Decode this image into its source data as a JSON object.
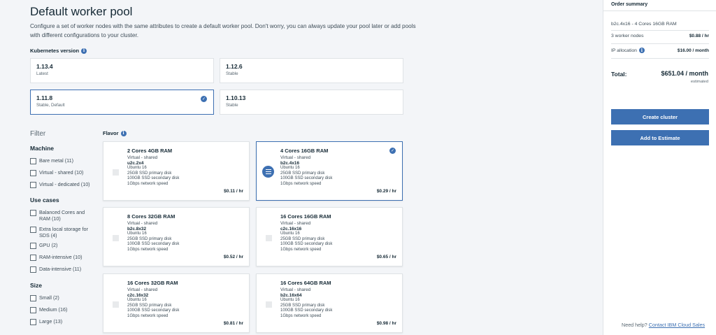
{
  "page": {
    "title": "Default worker pool",
    "description": "Configure a set of worker nodes with the same attributes to create a default worker pool. Don't worry, you can always update your pool later or add pools with different configurations to your cluster."
  },
  "kubernetes": {
    "label": "Kubernetes version",
    "versions": [
      {
        "version": "1.13.4",
        "status": "Latest"
      },
      {
        "version": "1.12.6",
        "status": "Stable"
      },
      {
        "version": "1.11.8",
        "status": "Stable, Default"
      },
      {
        "version": "1.10.13",
        "status": "Stable"
      }
    ],
    "selected": "1.11.8"
  },
  "filter": {
    "title": "Filter",
    "machine": {
      "label": "Machine",
      "options": [
        "Bare metal (11)",
        "Virtual - shared (10)",
        "Virtual - dedicated (10)"
      ]
    },
    "use_cases": {
      "label": "Use cases",
      "options": [
        "Balanced Cores and RAM (10)",
        "Extra local storage for SDS (4)",
        "GPU (2)",
        "RAM-intensive (10)",
        "Data-intensive (11)"
      ]
    },
    "size": {
      "label": "Size",
      "options": [
        "Small (2)",
        "Medium (16)",
        "Large (13)"
      ]
    }
  },
  "flavor": {
    "label": "Flavor",
    "cards": [
      {
        "title": "2 Cores 4GB RAM",
        "type": "Virtual - shared",
        "code": "u2c.2x4",
        "os": "Ubuntu 16",
        "primary": "25GB SSD primary disk",
        "secondary": "100GB SSD secondary disk",
        "network": "1Gbps network speed",
        "price": "$0.11 / hr"
      },
      {
        "title": "4 Cores 16GB RAM",
        "type": "Virtual - shared",
        "code": "b2c.4x16",
        "os": "Ubuntu 16",
        "primary": "25GB SSD primary disk",
        "secondary": "100GB SSD secondary disk",
        "network": "1Gbps network speed",
        "price": "$0.29 / hr"
      },
      {
        "title": "8 Cores 32GB RAM",
        "type": "Virtual - shared",
        "code": "b2c.8x32",
        "os": "Ubuntu 16",
        "primary": "25GB SSD primary disk",
        "secondary": "100GB SSD secondary disk",
        "network": "1Gbps network speed",
        "price": "$0.52 / hr"
      },
      {
        "title": "16 Cores 16GB RAM",
        "type": "Virtual - shared",
        "code": "c2c.16x16",
        "os": "Ubuntu 16",
        "primary": "25GB SSD primary disk",
        "secondary": "100GB SSD secondary disk",
        "network": "1Gbps network speed",
        "price": "$0.65 / hr"
      },
      {
        "title": "16 Cores 32GB RAM",
        "type": "Virtual - shared",
        "code": "c2c.16x32",
        "os": "Ubuntu 16",
        "primary": "25GB SSD primary disk",
        "secondary": "100GB SSD secondary disk",
        "network": "1Gbps network speed",
        "price": "$0.81 / hr"
      },
      {
        "title": "16 Cores 64GB RAM",
        "type": "Virtual - shared",
        "code": "b2c.16x64",
        "os": "Ubuntu 16",
        "primary": "25GB SSD primary disk",
        "secondary": "100GB SSD secondary disk",
        "network": "1Gbps network speed",
        "price": "$0.98 / hr"
      }
    ],
    "selected": "4 Cores 16GB RAM"
  },
  "summary": {
    "title": "Order summary",
    "config": "b2c.4x16 - 4 Cores 16GB RAM",
    "rows": [
      {
        "label": "3 worker nodes",
        "value": "$0.88 / hr"
      },
      {
        "label": "IP allocation",
        "value": "$16.00 / month"
      }
    ],
    "total_label": "Total:",
    "total_value": "$651.04 / month",
    "estimated": "estimated",
    "create_button": "Create cluster",
    "estimate_button": "Add to Estimate",
    "help_text": "Need help?",
    "help_link": "Contact IBM Cloud Sales"
  },
  "icons": {
    "info": "info-icon",
    "check": "checkmark-icon",
    "selected_flavor": "list-icon"
  },
  "colors": {
    "accent": "#3d70b2",
    "background": "#f3f5f8",
    "card": "#ffffff"
  }
}
